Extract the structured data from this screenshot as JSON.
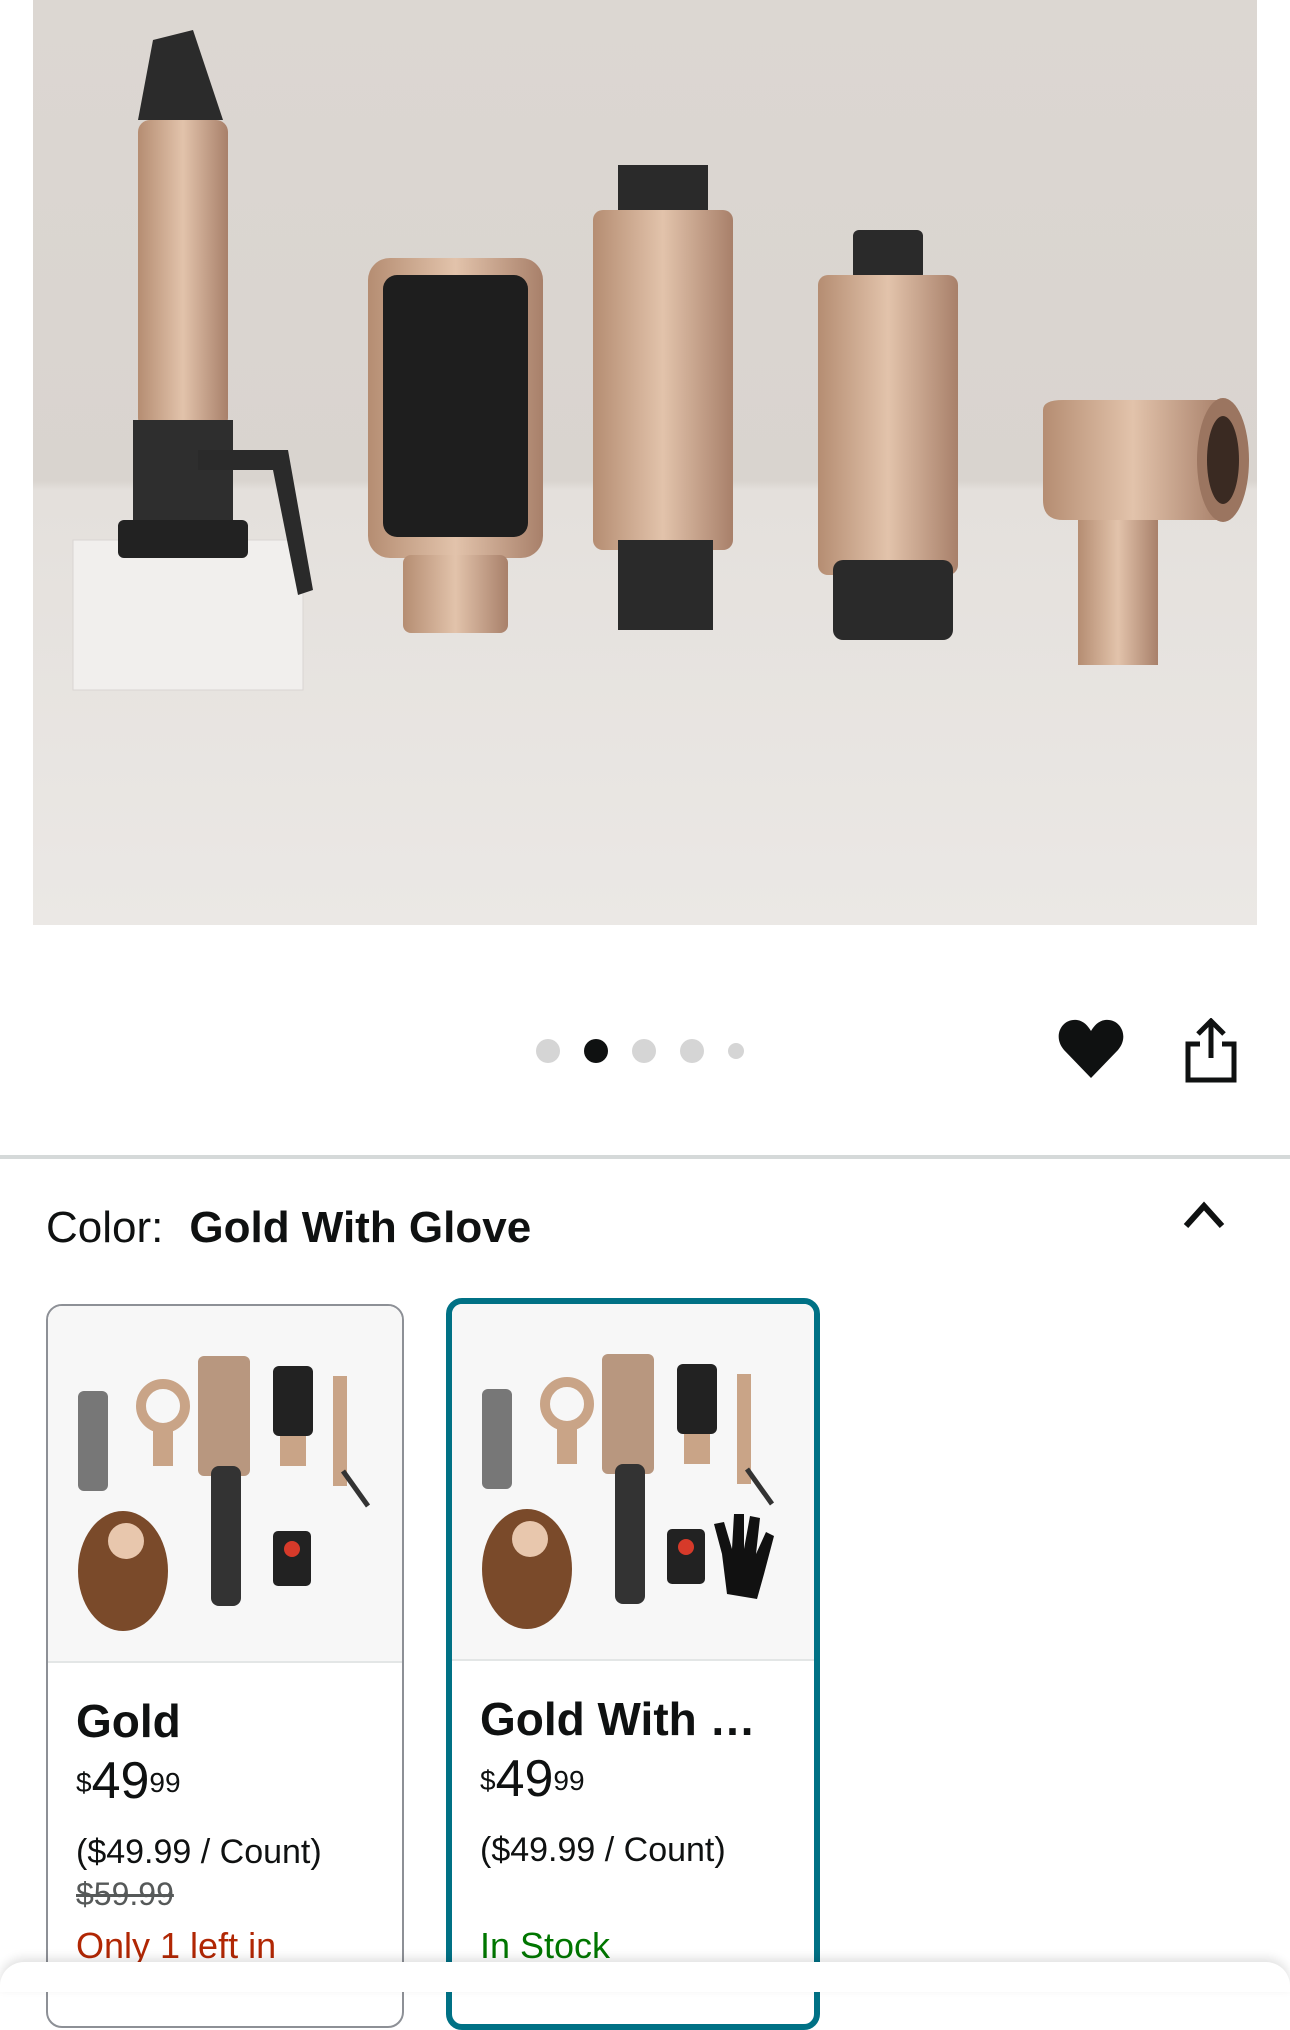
{
  "gallery": {
    "image_alt": "Hair styler attachments",
    "dots_total": 5,
    "active_dot": 2
  },
  "actions": {
    "favorite_icon": "heart-icon",
    "share_icon": "share-icon"
  },
  "variation": {
    "label": "Color:",
    "selected": "Gold With Glove",
    "collapse_icon": "chevron-up-icon"
  },
  "options": [
    {
      "name": "Gold",
      "price_symbol": "$",
      "price_whole": "49",
      "price_fraction": "99",
      "unit_price": "($49.99 / Count)",
      "list_price": "$59.99",
      "availability": "Only 1 left in"
    },
    {
      "name": "Gold With Glove",
      "price_symbol": "$",
      "price_whole": "49",
      "price_fraction": "99",
      "unit_price": "($49.99 / Count)",
      "availability": "In Stock"
    }
  ],
  "colors": {
    "selected_border": "#007185",
    "low_stock": "#b12704",
    "in_stock": "#007600",
    "rose_gold": "#c9a487"
  }
}
